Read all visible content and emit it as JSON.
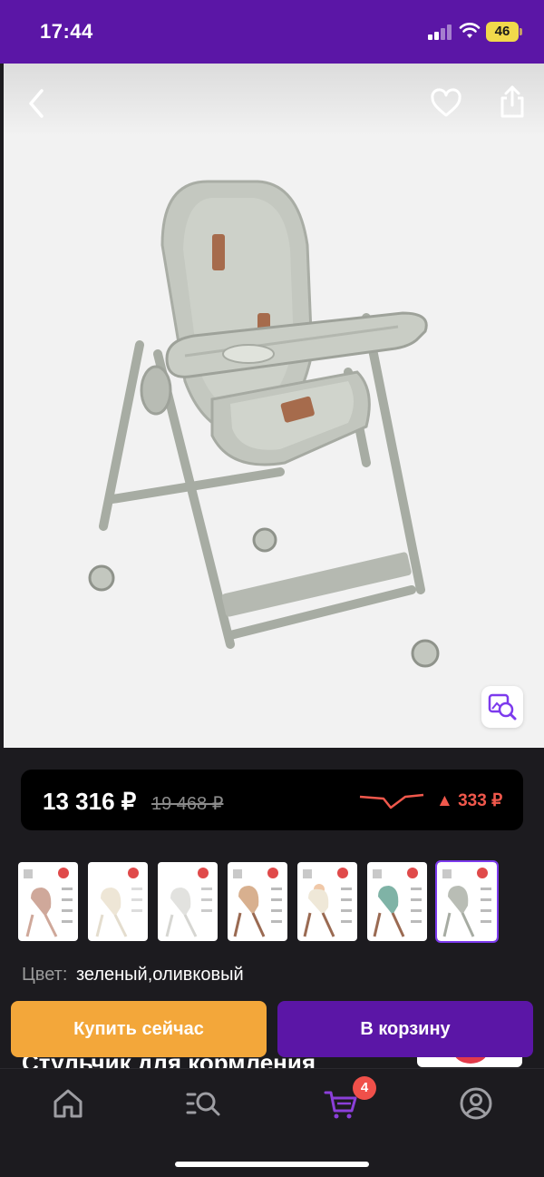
{
  "status": {
    "time": "17:44",
    "battery": "46"
  },
  "product": {
    "price_current": "13 316 ₽",
    "price_old": "19 468 ₽",
    "price_change": "▲ 333 ₽",
    "color_label": "Цвет:",
    "color_value": "зеленый,оливковый",
    "title_peek": "Стульчик для кормления",
    "thumbnail_count": 7,
    "selected_thumbnail": 7
  },
  "actions": {
    "buy_now": "Купить сейчас",
    "add_to_cart": "В корзину"
  },
  "tabbar": {
    "items": [
      "home-icon",
      "catalog-search-icon",
      "cart-icon",
      "profile-icon"
    ],
    "cart_badge": "4",
    "active_color": "#8b3fd9"
  },
  "colors": {
    "brand": "#5b16a6",
    "buy": "#f3a73a",
    "price_up": "#f0584c"
  }
}
